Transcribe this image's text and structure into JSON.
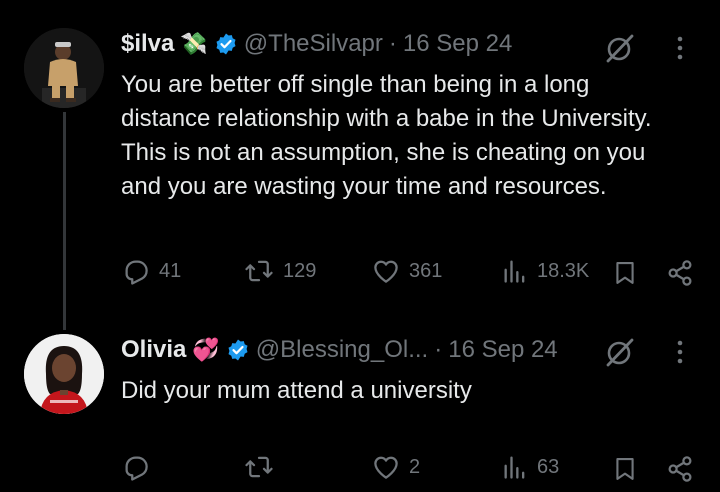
{
  "tweets": [
    {
      "name": "$ilva",
      "emoji": "💸",
      "handle": "@TheSilvapr",
      "separator": "·",
      "date": "16 Sep 24",
      "text": "You are better off single than being in a long distance relationship with a babe in the University. This is not an assumption, she is cheating on you and you are wasting your time and resources.",
      "replies": "41",
      "reposts": "129",
      "likes": "361",
      "views": "18.3K"
    },
    {
      "name": "Olivia",
      "emoji": "💞",
      "handle": "@Blessing_Ol...",
      "separator": "·",
      "date": "16 Sep 24",
      "text": "Did your mum attend a university",
      "replies": "",
      "reposts": "",
      "likes": "2",
      "views": "63"
    }
  ],
  "colors": {
    "background": "#000000",
    "text": "#e7e9ea",
    "muted": "#71767b",
    "verified": "#1d9bf0"
  },
  "icons": [
    "grok-icon",
    "more-icon",
    "reply-icon",
    "repost-icon",
    "like-icon",
    "views-icon",
    "bookmark-icon",
    "share-icon",
    "verified-badge-icon"
  ]
}
